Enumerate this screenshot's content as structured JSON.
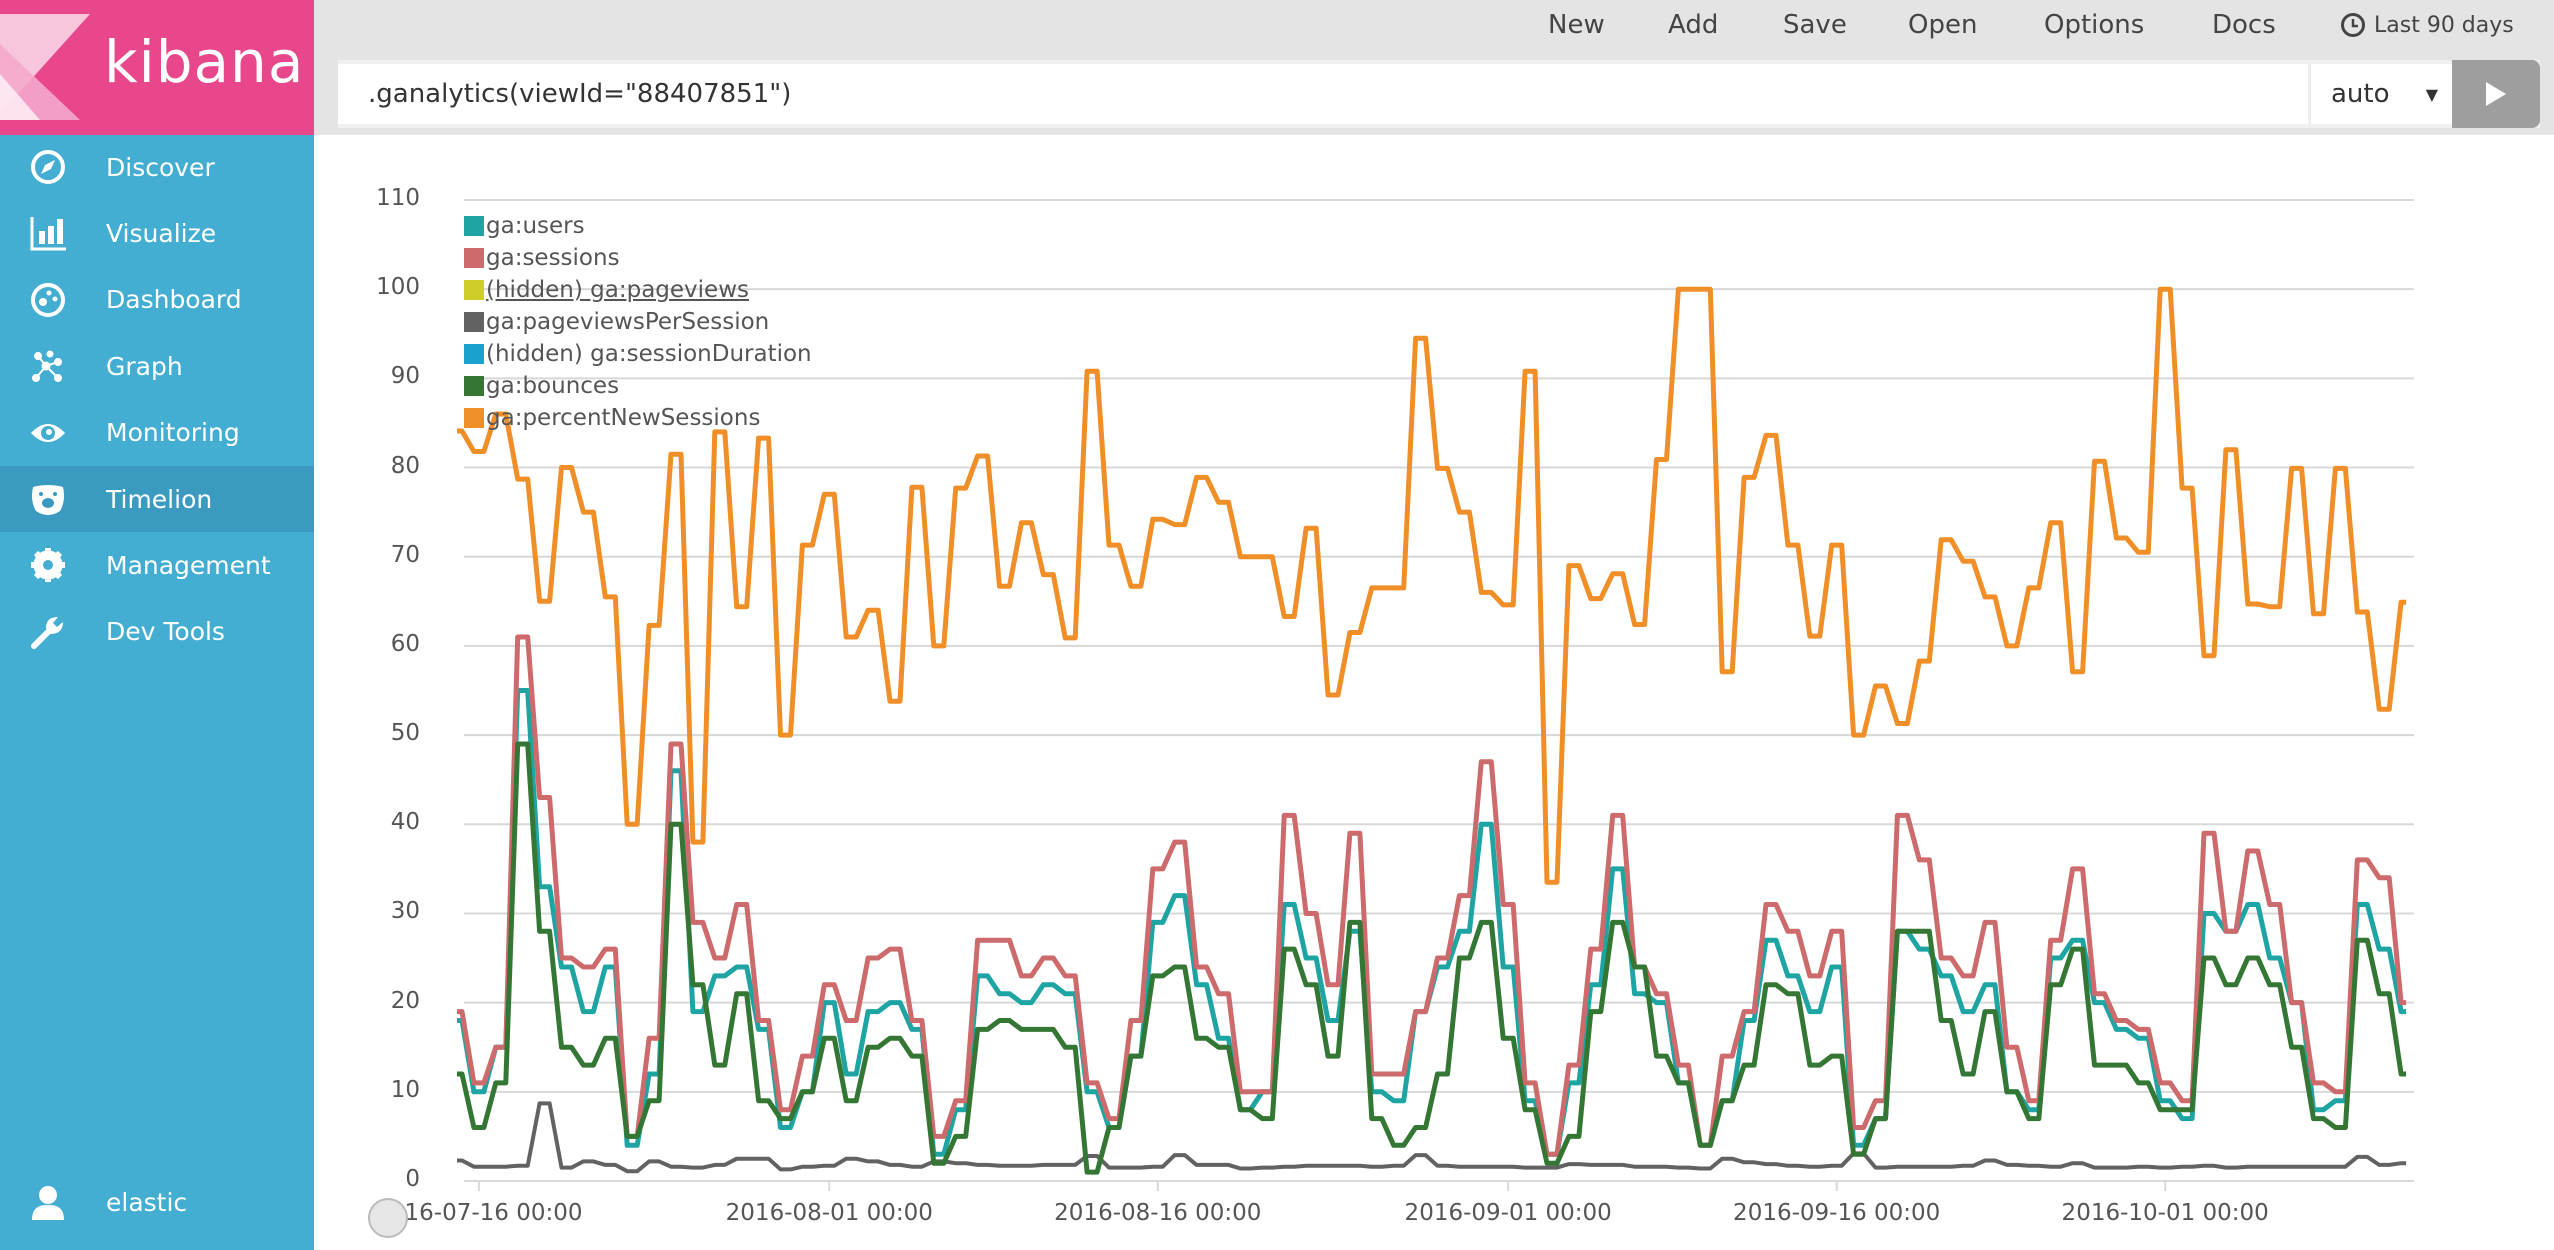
{
  "app": {
    "brand": "kibana",
    "brand_color": "#e8488b",
    "sidebar_color": "#43aed1"
  },
  "sidebar": {
    "items": [
      {
        "label": "Discover",
        "icon": "compass-icon"
      },
      {
        "label": "Visualize",
        "icon": "bar-chart-icon"
      },
      {
        "label": "Dashboard",
        "icon": "dashboard-icon"
      },
      {
        "label": "Graph",
        "icon": "graph-icon"
      },
      {
        "label": "Monitoring",
        "icon": "eye-icon"
      },
      {
        "label": "Timelion",
        "icon": "bear-icon",
        "active": true
      },
      {
        "label": "Management",
        "icon": "gear-icon"
      },
      {
        "label": "Dev Tools",
        "icon": "wrench-icon"
      }
    ],
    "user": {
      "label": "elastic",
      "icon": "user-icon"
    }
  },
  "topbar": {
    "menu": [
      "New",
      "Add",
      "Save",
      "Open",
      "Options",
      "Docs"
    ],
    "time_range": "Last 90 days",
    "query": ".ganalytics(viewId=\"88407851\")",
    "interval": "auto",
    "run_icon": "play-icon"
  },
  "chart_data": {
    "type": "line",
    "x_start": "2016-07-15",
    "x_interval": "1d",
    "xticks": [
      "2016-07-16 00:00",
      "2016-08-01 00:00",
      "2016-08-16 00:00",
      "2016-09-01 00:00",
      "2016-09-16 00:00",
      "2016-10-01 00:00"
    ],
    "xtick_dates": [
      "2016-07-16",
      "2016-08-01",
      "2016-08-16",
      "2016-09-01",
      "2016-09-16",
      "2016-10-01"
    ],
    "ylim": [
      0,
      110
    ],
    "yticks": [
      0,
      10,
      20,
      30,
      40,
      50,
      60,
      70,
      80,
      90,
      100,
      110
    ],
    "grid": true,
    "legend_position": "top-left",
    "series": [
      {
        "name": "ga:users",
        "color": "#1ea5a3",
        "hidden": false,
        "values": [
          18,
          10,
          15,
          55,
          33,
          24,
          19,
          24,
          4,
          12,
          46,
          19,
          23,
          24,
          17,
          6,
          10,
          20,
          12,
          19,
          20,
          17,
          3,
          8,
          23,
          21,
          20,
          22,
          21,
          10,
          6,
          14,
          29,
          32,
          22,
          16,
          8,
          10,
          31,
          25,
          18,
          28,
          10,
          9,
          19,
          24,
          28,
          40,
          24,
          9,
          3,
          11,
          22,
          35,
          21,
          20,
          11,
          4,
          9,
          18,
          27,
          23,
          19,
          24,
          4,
          7,
          28,
          26,
          23,
          19,
          22,
          10,
          8,
          25,
          27,
          20,
          17,
          16,
          9,
          7,
          30,
          28,
          31,
          25,
          20,
          8,
          9,
          31,
          26,
          19
        ]
      },
      {
        "name": "ga:sessions",
        "color": "#cc6a6c",
        "hidden": false,
        "values": [
          19,
          11,
          15,
          61,
          43,
          25,
          24,
          26,
          5,
          16,
          49,
          29,
          25,
          31,
          18,
          8,
          14,
          22,
          18,
          25,
          26,
          18,
          5,
          9,
          27,
          27,
          23,
          25,
          23,
          11,
          7,
          18,
          35,
          38,
          24,
          21,
          10,
          10,
          41,
          30,
          22,
          39,
          12,
          12,
          19,
          25,
          32,
          47,
          31,
          11,
          3,
          13,
          26,
          41,
          24,
          21,
          13,
          4,
          14,
          19,
          31,
          28,
          23,
          28,
          6,
          9,
          41,
          36,
          25,
          23,
          29,
          15,
          9,
          27,
          35,
          21,
          18,
          17,
          11,
          9,
          39,
          28,
          37,
          31,
          20,
          11,
          10,
          36,
          34,
          20
        ]
      },
      {
        "name": "(hidden) ga:pageviews",
        "color": "#cfcd2a",
        "hidden": true,
        "values": []
      },
      {
        "name": "ga:pageviewsPerSession",
        "color": "#626262",
        "hidden": false,
        "values": [
          2.3,
          1.6,
          1.6,
          1.7,
          8.7,
          1.5,
          2.2,
          1.8,
          1.1,
          2.2,
          1.6,
          1.5,
          1.8,
          2.5,
          2.5,
          1.3,
          1.6,
          1.7,
          2.5,
          2.2,
          1.8,
          1.6,
          2.2,
          2.0,
          1.8,
          1.7,
          1.7,
          1.8,
          1.8,
          2.8,
          1.5,
          1.5,
          1.6,
          2.9,
          1.8,
          1.8,
          1.4,
          1.5,
          1.6,
          1.7,
          1.7,
          1.7,
          1.6,
          1.7,
          2.9,
          1.7,
          1.6,
          1.6,
          1.6,
          1.5,
          1.5,
          1.9,
          1.8,
          1.8,
          1.6,
          1.6,
          1.5,
          1.4,
          2.5,
          2.1,
          1.9,
          1.7,
          1.6,
          1.7,
          3.1,
          1.5,
          1.6,
          1.6,
          1.6,
          1.7,
          2.3,
          1.8,
          1.7,
          1.6,
          2.0,
          1.5,
          1.5,
          1.6,
          1.5,
          1.6,
          1.7,
          1.5,
          1.6,
          1.6,
          1.6,
          1.6,
          1.6,
          2.7,
          1.8,
          2.0
        ]
      },
      {
        "name": "(hidden) ga:sessionDuration",
        "color": "#1ba1cd",
        "hidden": true,
        "values": []
      },
      {
        "name": "ga:bounces",
        "color": "#347634",
        "hidden": false,
        "values": [
          12,
          6,
          11,
          49,
          28,
          15,
          13,
          16,
          5,
          9,
          40,
          22,
          13,
          21,
          9,
          7,
          10,
          16,
          9,
          15,
          16,
          14,
          2,
          5,
          17,
          18,
          17,
          17,
          15,
          1,
          6,
          14,
          23,
          24,
          16,
          15,
          8,
          7,
          26,
          22,
          14,
          29,
          7,
          4,
          6,
          12,
          25,
          29,
          16,
          8,
          2,
          5,
          19,
          29,
          24,
          14,
          11,
          4,
          9,
          13,
          22,
          21,
          13,
          14,
          3,
          7,
          28,
          28,
          18,
          12,
          19,
          10,
          7,
          22,
          26,
          13,
          13,
          11,
          8,
          8,
          25,
          22,
          25,
          22,
          15,
          7,
          6,
          27,
          21,
          12
        ]
      },
      {
        "name": "ga:percentNewSessions",
        "color": "#f08e27",
        "hidden": false,
        "values": [
          84.1,
          81.8,
          86,
          78.7,
          65,
          80,
          75,
          65.5,
          40,
          62.3,
          81.5,
          38,
          84,
          64.4,
          83.3,
          50,
          71.3,
          77,
          61,
          64,
          53.8,
          77.8,
          60,
          77.7,
          81.3,
          66.7,
          73.8,
          68,
          60.9,
          90.8,
          71.3,
          66.7,
          74.2,
          73.6,
          78.9,
          76.1,
          70,
          70,
          63.3,
          73.2,
          54.5,
          61.5,
          66.5,
          66.5,
          94.5,
          79.9,
          75,
          66,
          64.6,
          90.8,
          33.5,
          69,
          65.3,
          68.1,
          62.4,
          80.9,
          100,
          100,
          57.1,
          78.9,
          83.6,
          71.3,
          61.1,
          71.3,
          50,
          55.5,
          51.3,
          58.3,
          71.9,
          69.5,
          65.5,
          60,
          66.5,
          73.8,
          57.1,
          80.7,
          72.1,
          70.5,
          100,
          77.7,
          58.9,
          82,
          64.7,
          64.4,
          79.9,
          63.6,
          79.9,
          63.8,
          52.9,
          64.9
        ]
      }
    ]
  }
}
